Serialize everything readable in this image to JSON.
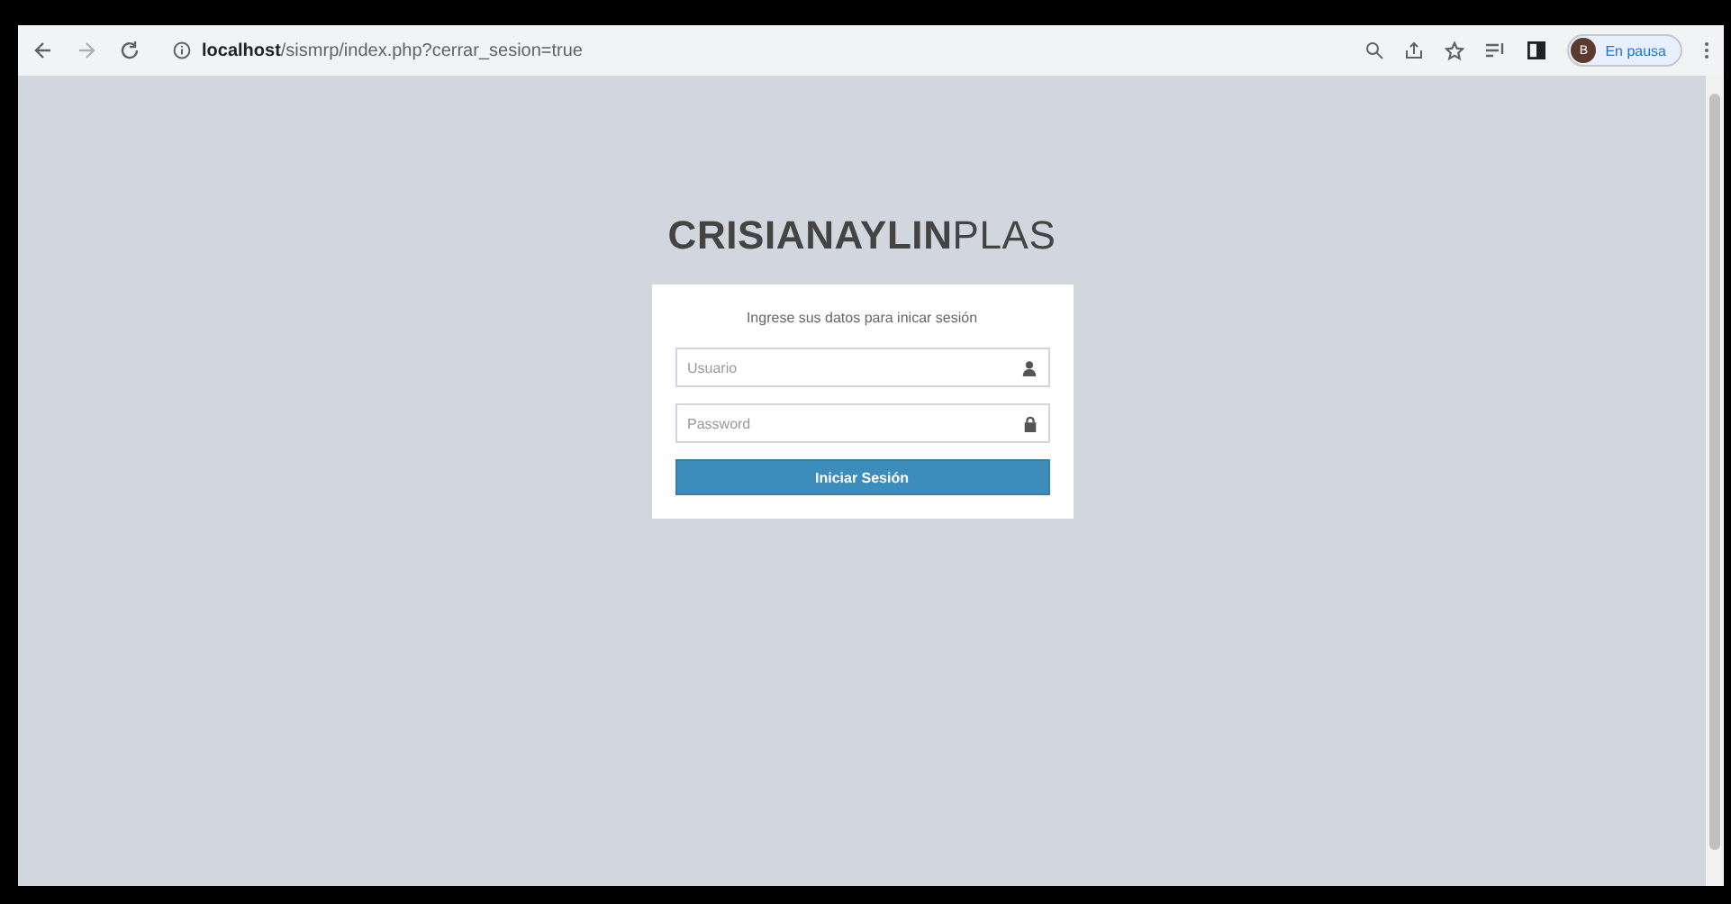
{
  "browser": {
    "url": "**localhost**/sismrp/index.php?cerrar_sesion=true",
    "profile_initial": "B",
    "profile_status": "En pausa"
  },
  "logo": "**CRISIANAYLIN**PLAS",
  "login": {
    "message": "Ingrese sus datos para inicar sesión",
    "fields": [
      {
        "kind": "user",
        "placeholder": "Usuario"
      },
      {
        "kind": "password",
        "placeholder": "Password"
      }
    ],
    "button": "Iniciar Sesión"
  }
}
